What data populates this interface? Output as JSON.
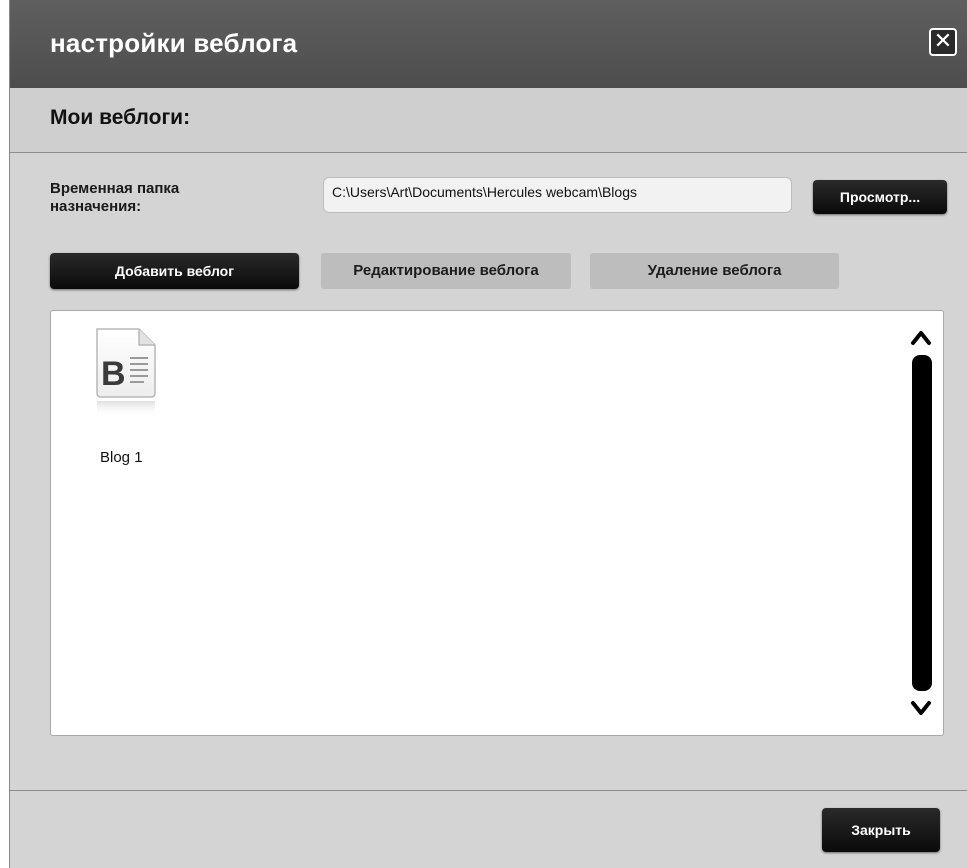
{
  "window": {
    "title": "настройки веблога",
    "close_icon_glyph": "✕"
  },
  "section": {
    "title": "Мои веблоги:"
  },
  "folder": {
    "label": "Временная папка назначения:",
    "path": "C:\\Users\\Art\\Documents\\Hercules webcam\\Blogs",
    "browse_label": "Просмотр..."
  },
  "actions": {
    "add_label": "Добавить веблог",
    "edit_label": "Редактирование веблога",
    "delete_label": "Удаление веблога"
  },
  "blogs": [
    {
      "name": "Blog 1",
      "icon": "blog-document-icon"
    }
  ],
  "footer": {
    "close_label": "Закрыть"
  },
  "colors": {
    "titlebar": "#555555",
    "dialog_bg": "#d4d4d4",
    "button_dark": "#111111",
    "button_disabled": "#bdbdbd"
  }
}
